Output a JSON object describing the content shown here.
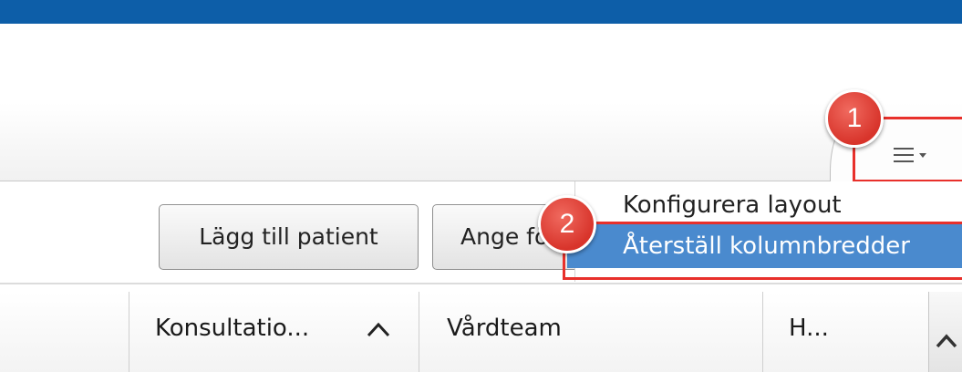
{
  "app": {
    "accent_color": "#0d5ea8",
    "highlight_color": "#e8302b"
  },
  "tab_menu": {
    "icon": "hamburger-menu-icon"
  },
  "toolbar": {
    "add_patient_label": "Lägg till patient",
    "ange_label": "Ange fö"
  },
  "dropdown": {
    "items": [
      {
        "label": "Konfigurera layout",
        "selected": false
      },
      {
        "label": "Återställ kolumnbredder",
        "selected": true
      }
    ],
    "selected_color": "#4a8ace"
  },
  "callouts": [
    "1",
    "2"
  ],
  "table": {
    "columns": [
      {
        "label": "Konsultatio...",
        "sorted": "ascending"
      },
      {
        "label": "Vårdteam"
      },
      {
        "label": "H..."
      }
    ]
  }
}
